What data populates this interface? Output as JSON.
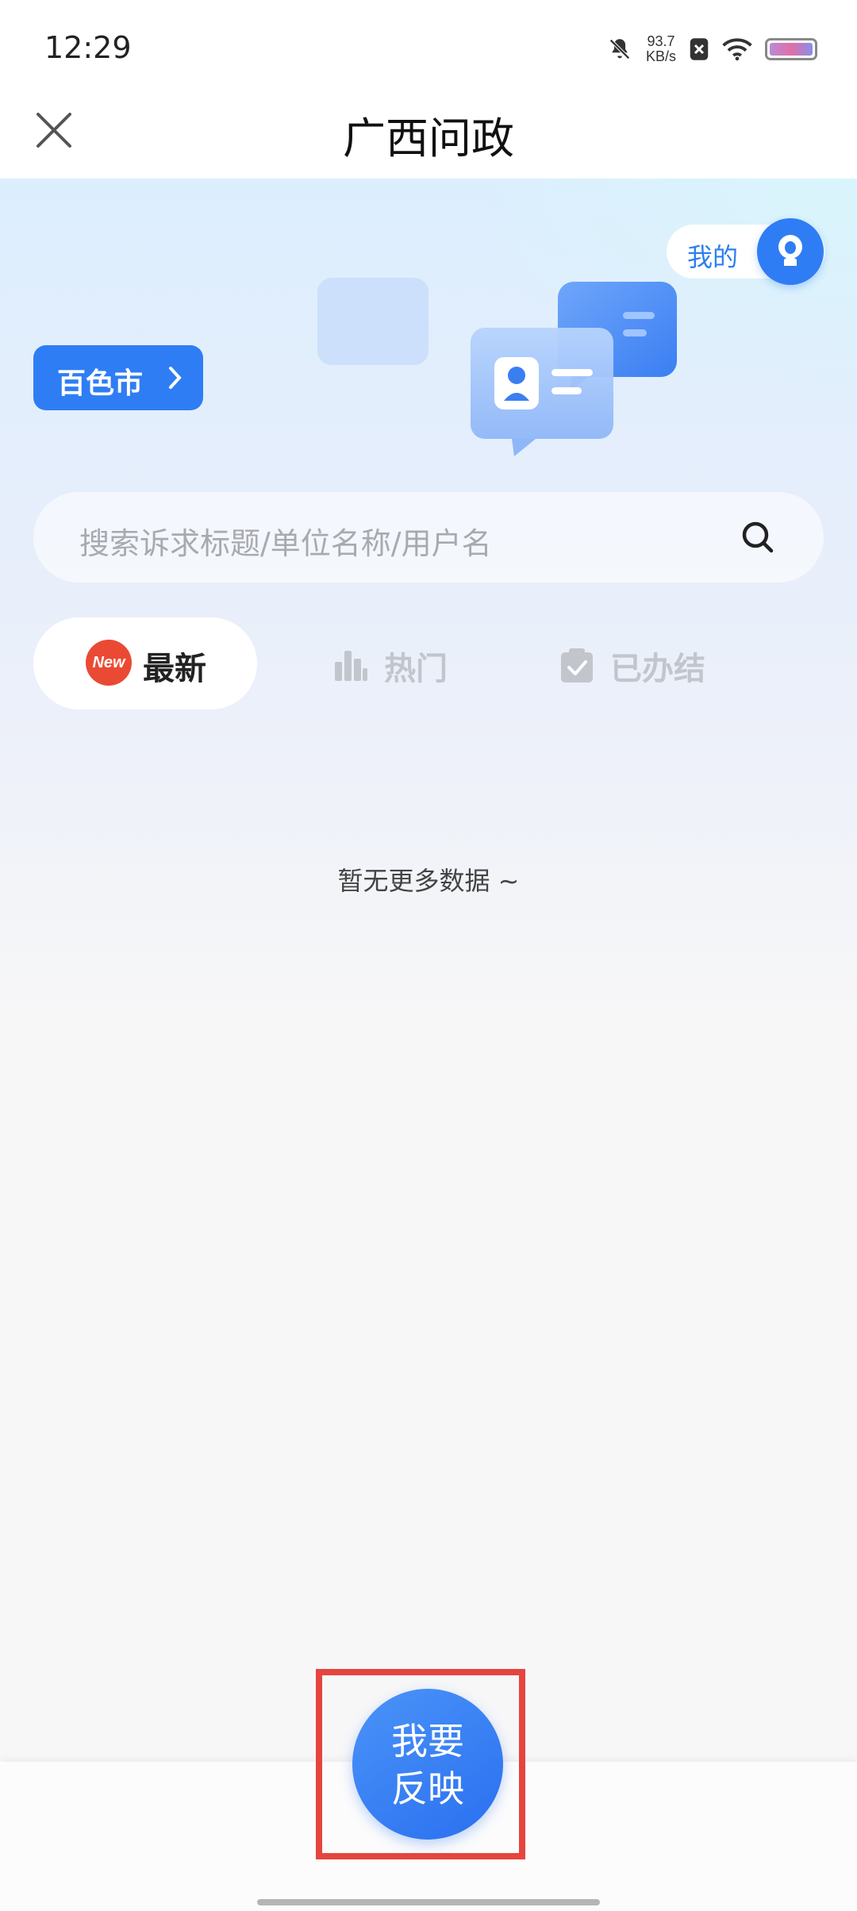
{
  "status_bar": {
    "time": "12:29",
    "net_speed_value": "93.7",
    "net_speed_unit": "KB/s",
    "icons": [
      "mute-bell-icon",
      "sim-x-icon",
      "wifi-icon",
      "battery-icon"
    ]
  },
  "nav": {
    "title": "广西问政",
    "close_icon": "close-icon"
  },
  "header": {
    "mine_label": "我的",
    "city_label": "百色市"
  },
  "search": {
    "placeholder": "搜索诉求标题/单位名称/用户名"
  },
  "tabs": [
    {
      "label": "最新",
      "badge": "New",
      "active": true,
      "icon": "new-badge-icon"
    },
    {
      "label": "热门",
      "active": false,
      "icon": "bar-chart-icon"
    },
    {
      "label": "已办结",
      "active": false,
      "icon": "clipboard-check-icon"
    }
  ],
  "list": {
    "empty_text": "暂无更多数据 ~"
  },
  "fab": {
    "line1": "我要",
    "line2": "反映"
  },
  "colors": {
    "primary": "#2f7df4",
    "badge_red": "#ea4a34",
    "highlight_red": "#e5453e",
    "inactive_tab": "#c2c6cc"
  }
}
